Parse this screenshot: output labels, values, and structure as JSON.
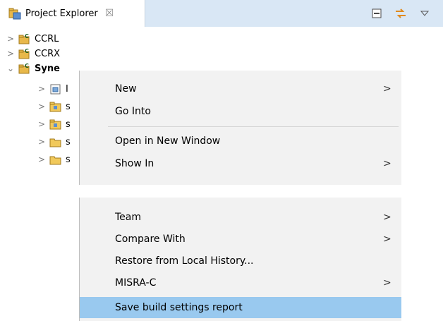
{
  "view": {
    "tab_title": "Project Explorer",
    "tab_close_glyph": "☒",
    "tab_icon": "project-explorer-icon",
    "tools": [
      "collapse-all-icon",
      "link-with-editor-icon",
      "view-menu-icon"
    ]
  },
  "tree": {
    "items": [
      {
        "label": "CCRL",
        "expanded": false,
        "bold": false,
        "icon": "c-project-icon"
      },
      {
        "label": "CCRX",
        "expanded": false,
        "bold": false,
        "icon": "c-project-icon"
      },
      {
        "label": "Syne",
        "expanded": true,
        "bold": true,
        "icon": "c-project-icon"
      }
    ],
    "children": [
      {
        "label": "I",
        "icon": "includes-icon"
      },
      {
        "label": "s",
        "icon": "source-folder-icon"
      },
      {
        "label": "s",
        "icon": "source-folder-icon"
      },
      {
        "label": "s",
        "icon": "folder-icon"
      },
      {
        "label": "s",
        "icon": "folder-icon"
      }
    ]
  },
  "menu": {
    "top_items": [
      {
        "label": "New",
        "submenu": true
      },
      {
        "label": "Go Into",
        "submenu": false
      },
      {
        "label": "Open in New Window",
        "submenu": false
      },
      {
        "label": "Show In",
        "submenu": true
      }
    ],
    "bottom_items": [
      {
        "label": "Team",
        "submenu": true
      },
      {
        "label": "Compare With",
        "submenu": true
      },
      {
        "label": "Restore from Local History...",
        "submenu": false
      },
      {
        "label": "MISRA-C",
        "submenu": true
      },
      {
        "label": "Save build settings report",
        "submenu": false,
        "highlighted": true
      }
    ],
    "submenu_arrow": ">"
  },
  "colors": {
    "tab_bar": "#d9e7f5",
    "menu_bg": "#f2f2f2",
    "highlight": "#99c9ef"
  }
}
